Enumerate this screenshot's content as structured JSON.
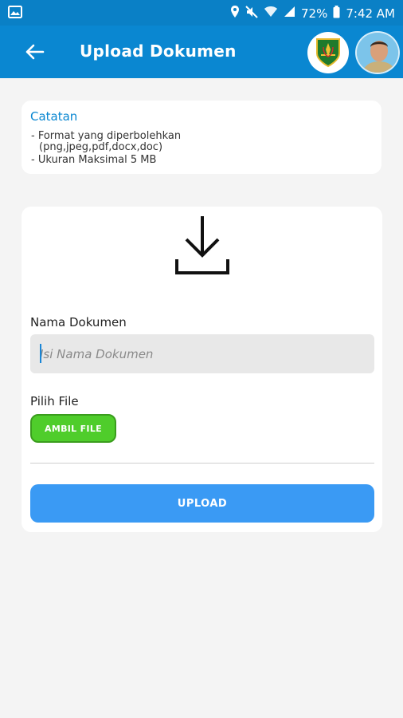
{
  "status_bar": {
    "battery": "72%",
    "time": "7:42 AM",
    "icons": [
      "image-icon",
      "location-icon",
      "mute-icon",
      "wifi-icon",
      "signal-icon",
      "battery-icon"
    ]
  },
  "app_bar": {
    "title": "Upload Dokumen",
    "back_icon": "arrow-left-icon",
    "emblem": "regional-emblem",
    "avatar": "user-avatar"
  },
  "note": {
    "title": "Catatan",
    "lines": [
      "- Format yang diperbolehkan",
      "(png,jpeg,pdf,docx,doc)",
      "- Ukuran Maksimal 5 MB"
    ]
  },
  "upload": {
    "icon": "download-icon",
    "name_label": "Nama Dokumen",
    "name_placeholder": "Isi Nama Dokumen",
    "name_value": "",
    "file_label": "Pilih File",
    "file_button": "AMBIL FILE",
    "submit_button": "UPLOAD"
  },
  "colors": {
    "status_bar": "#0a80c6",
    "app_bar": "#0a87d1",
    "accent_text": "#0a87d1",
    "file_button": "#4fcd2b",
    "submit_button": "#3a9af4",
    "background": "#f4f4f4"
  }
}
